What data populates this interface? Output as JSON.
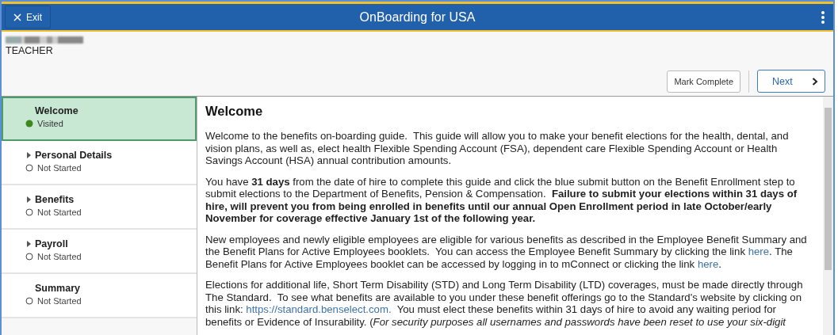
{
  "header": {
    "exit_label": "Exit",
    "title": "OnBoarding for USA"
  },
  "user": {
    "name_redacted": true,
    "role": "TEACHER"
  },
  "actions": {
    "mark_complete": "Mark Complete",
    "next": "Next"
  },
  "steps": [
    {
      "label": "Welcome",
      "status": "Visited",
      "visited": true,
      "selected": true,
      "expandable": false
    },
    {
      "label": "Personal Details",
      "status": "Not Started",
      "visited": false,
      "selected": false,
      "expandable": true
    },
    {
      "label": "Benefits",
      "status": "Not Started",
      "visited": false,
      "selected": false,
      "expandable": true
    },
    {
      "label": "Payroll",
      "status": "Not Started",
      "visited": false,
      "selected": false,
      "expandable": true
    },
    {
      "label": "Summary",
      "status": "Not Started",
      "visited": false,
      "selected": false,
      "expandable": false
    }
  ],
  "content": {
    "heading": "Welcome",
    "paragraphs": [
      [
        {
          "kind": "text",
          "text": "Welcome to the benefits on-boarding guide.  This guide will allow you to make your benefit elections for the health, dental, and vision plans, as well as, elect health Flexible Spending Account (FSA), dependent care Flexible Spending Account or Health Savings Account (HSA) annual contribution amounts."
        }
      ],
      [
        {
          "kind": "text",
          "text": "You have **31 days** from the date of hire to complete this guide and click the blue submit button on the Benefit Enrollment step to submit elections to the Department of Benefits, Pension & Compensation.  **Failure to submit your elections within 31 days of hire, will prevent you from being enrolled in benefits until our annual Open Enrollment period in late October/early November for coverage effective January 1st of the following year.**"
        }
      ],
      [
        {
          "kind": "text",
          "text": "New employees and newly eligible employees are eligible for various benefits as described in the Employee Benefit Summary and the Benefit Plans for Active Employees booklets.  You can access the Employee Benefit Summary by clicking the link "
        },
        {
          "kind": "link",
          "text": "here"
        },
        {
          "kind": "text",
          "text": ". The Benefit Plans for Active Employees booklet can be accessed by logging in to mConnect or clicking the link "
        },
        {
          "kind": "link",
          "text": "here"
        },
        {
          "kind": "text",
          "text": "."
        }
      ],
      [
        {
          "kind": "text",
          "text": "Elections for additional life, Short Term Disability (STD) and Long Term Disability (LTD) coverages, must be made directly through The Standard.  To see what benefits are available to you under these benefit offerings go to the Standard's website by clicking on this link: "
        },
        {
          "kind": "link",
          "text": "https://standard.benselect.com."
        },
        {
          "kind": "text",
          "text": "  You must elect these benefits within 31 days of hire to avoid any waiting period for benefits or Evidence of Insurability. (*For security purposes all usernames and passwords have been reset to use your six-digit*"
        }
      ]
    ]
  }
}
